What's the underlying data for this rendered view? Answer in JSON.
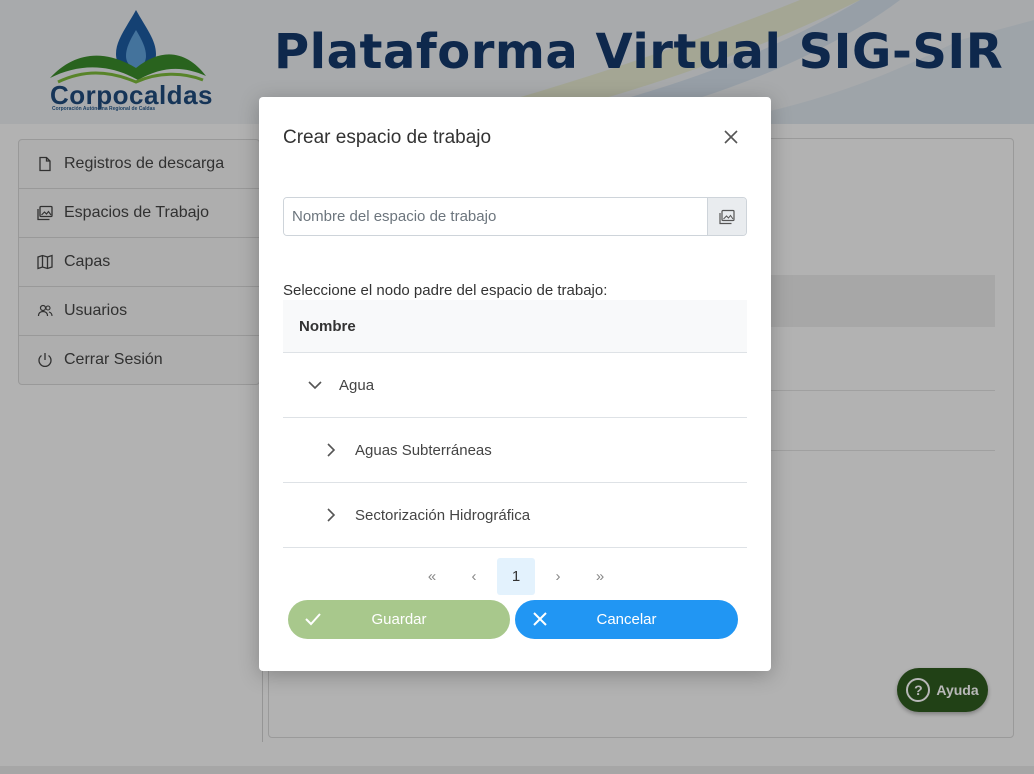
{
  "header": {
    "logo_name": "Corpocaldas",
    "logo_subtitle": "Corporación Autónoma Regional de Caldas",
    "title": "Plataforma Virtual SIG-SIR"
  },
  "sidebar": {
    "items": [
      {
        "label": "Registros de descarga",
        "icon": "file-icon"
      },
      {
        "label": "Espacios de Trabajo",
        "icon": "images-icon"
      },
      {
        "label": "Capas",
        "icon": "map-icon"
      },
      {
        "label": "Usuarios",
        "icon": "users-icon"
      },
      {
        "label": "Cerrar Sesión",
        "icon": "power-icon"
      }
    ]
  },
  "modal": {
    "title": "Crear espacio de trabajo",
    "name_input": {
      "placeholder": "Nombre del espacio de trabajo",
      "value": ""
    },
    "select_label": "Seleccione el nodo padre del espacio de trabajo:",
    "table_header": "Nombre",
    "rows": [
      {
        "label": "Agua",
        "state": "expanded"
      },
      {
        "label": "Aguas Subterráneas",
        "state": "collapsed"
      },
      {
        "label": "Sectorización Hidrográfica",
        "state": "collapsed"
      }
    ],
    "pagination": {
      "first": "«",
      "prev": "‹",
      "current": "1",
      "next": "›",
      "last": "»"
    },
    "save_label": "Guardar",
    "cancel_label": "Cancelar"
  },
  "help": {
    "label": "Ayuda"
  },
  "colors": {
    "title": "#14386a",
    "save": "#a8c88c",
    "cancel": "#2196f3",
    "help": "#2f5a1f"
  }
}
